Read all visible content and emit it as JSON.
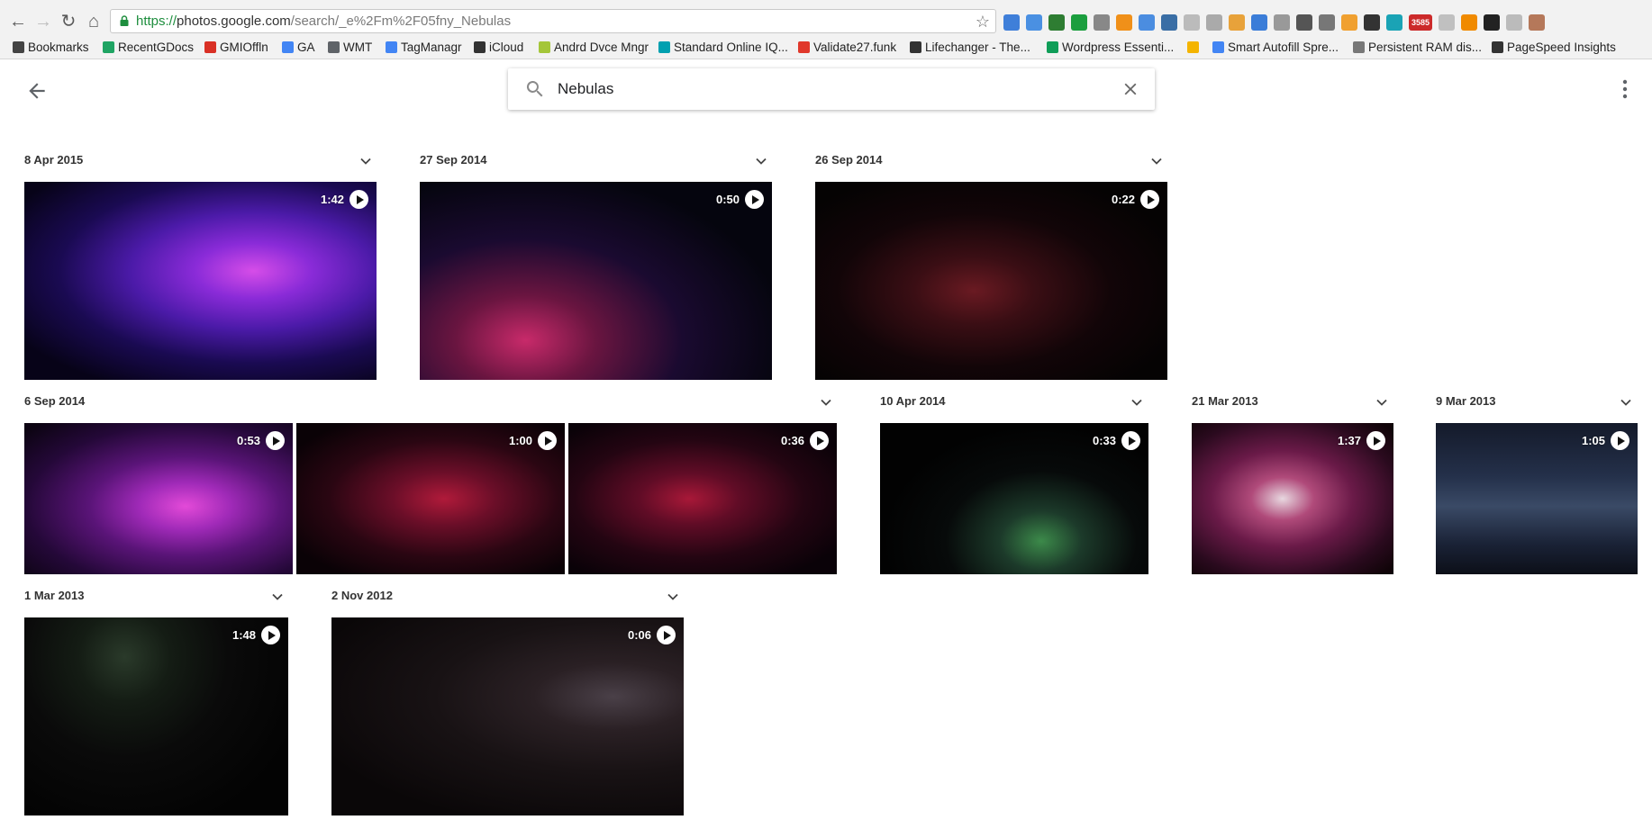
{
  "browser": {
    "url_scheme": "https://",
    "url_host": "photos.google.com",
    "url_path": "/search/_e%2Fm%2F05fny_Nebulas",
    "bookmarks": [
      {
        "label": "Bookmarks",
        "icon": "star-icon",
        "color": "#444444"
      },
      {
        "label": "RecentGDocs",
        "icon": "drive-icon",
        "color": "#1fa463"
      },
      {
        "label": "GMIOffln",
        "icon": "gmail-icon",
        "color": "#d93025"
      },
      {
        "label": "GA",
        "icon": "google-icon",
        "color": "#4285f4"
      },
      {
        "label": "WMT",
        "icon": "wmt-icon",
        "color": "#5f6368"
      },
      {
        "label": "TagManagr",
        "icon": "tagmanager-icon",
        "color": "#4285f4"
      },
      {
        "label": "iCloud",
        "icon": "apple-icon",
        "color": "#333333"
      },
      {
        "label": "Andrd Dvce Mngr",
        "icon": "android-icon",
        "color": "#a4c639"
      },
      {
        "label": "Standard Online IQ...",
        "icon": "iq-icon",
        "color": "#00a0b0"
      },
      {
        "label": "Validate27.funk",
        "icon": "validate-icon",
        "color": "#e0382b"
      },
      {
        "label": "Lifechanger - The...",
        "icon": "pin-icon",
        "color": "#333333"
      },
      {
        "label": "Wordpress Essenti...",
        "icon": "sheets-icon",
        "color": "#0f9d58"
      },
      {
        "label": "",
        "icon": "chart-icon",
        "color": "#f4b400"
      },
      {
        "label": "Smart Autofill Spre...",
        "icon": "autofill-icon",
        "color": "#4285f4"
      },
      {
        "label": "Persistent RAM dis...",
        "icon": "link-icon",
        "color": "#777777"
      },
      {
        "label": "PageSpeed Insights",
        "icon": "pagespeed-icon",
        "color": "#333333"
      }
    ],
    "extension_badge": "3585"
  },
  "search": {
    "query": "Nebulas"
  },
  "groups": [
    {
      "date": "8 Apr 2015",
      "videos": [
        {
          "duration": "1:42"
        }
      ]
    },
    {
      "date": "27 Sep 2014",
      "videos": [
        {
          "duration": "0:50"
        }
      ]
    },
    {
      "date": "26 Sep 2014",
      "videos": [
        {
          "duration": "0:22"
        }
      ]
    },
    {
      "date": "6 Sep 2014",
      "videos": [
        {
          "duration": "0:53"
        },
        {
          "duration": "1:00"
        },
        {
          "duration": "0:36"
        }
      ]
    },
    {
      "date": "10 Apr 2014",
      "videos": [
        {
          "duration": "0:33"
        }
      ]
    },
    {
      "date": "21 Mar 2013",
      "videos": [
        {
          "duration": "1:37"
        }
      ]
    },
    {
      "date": "9 Mar 2013",
      "videos": [
        {
          "duration": "1:05"
        }
      ]
    },
    {
      "date": "1 Mar 2013",
      "videos": [
        {
          "duration": "1:48"
        }
      ]
    },
    {
      "date": "2 Nov 2012",
      "videos": [
        {
          "duration": "0:06"
        }
      ]
    }
  ]
}
